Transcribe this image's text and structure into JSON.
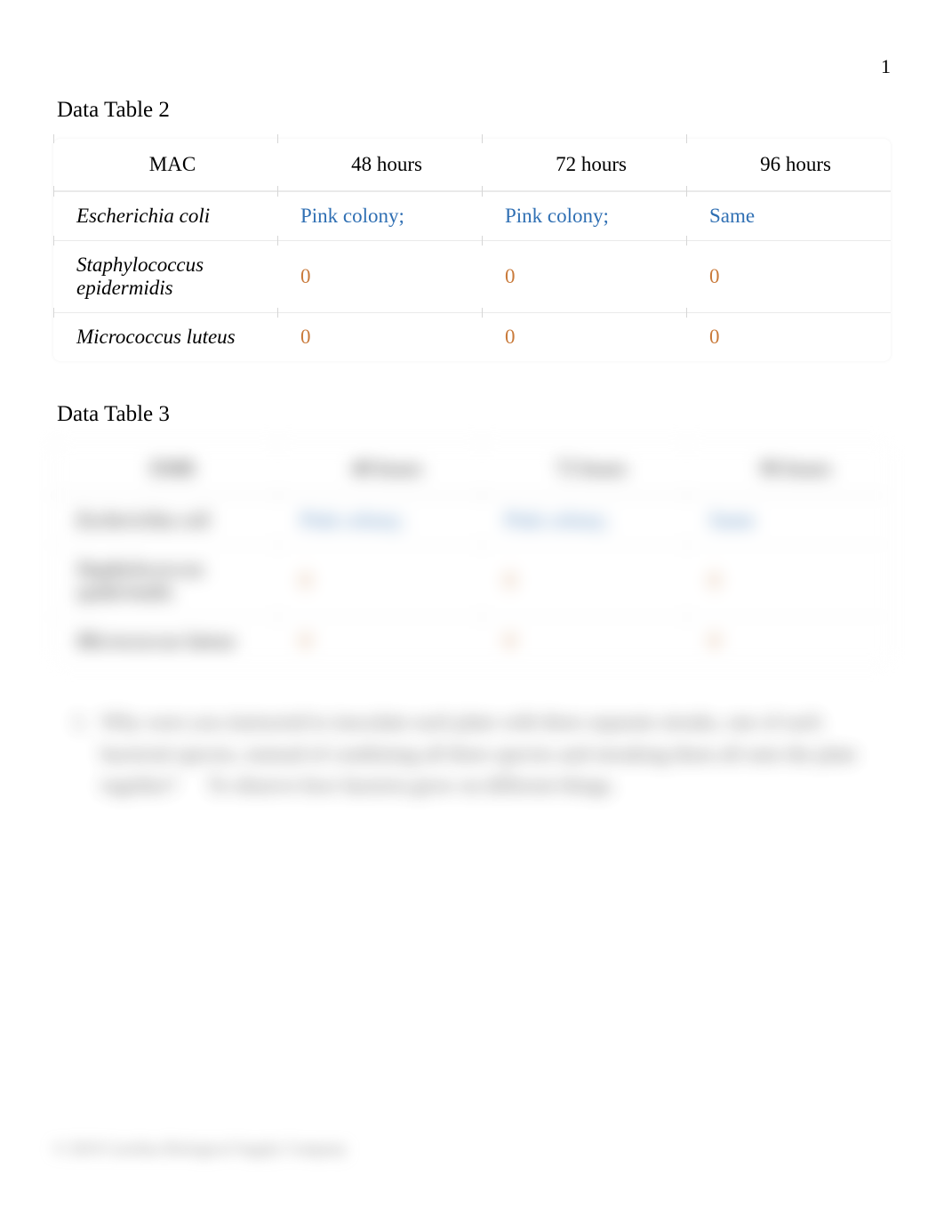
{
  "page_number": "1",
  "table2": {
    "title": "Data Table 2",
    "header": [
      "MAC",
      "48 hours",
      "72 hours",
      "96 hours"
    ],
    "rows": [
      {
        "name": "Escherichia coli",
        "italic": true,
        "values": [
          "Pink colony;",
          "Pink colony;",
          "Same"
        ],
        "color": "blue"
      },
      {
        "name": "Staphylococcus epidermidis",
        "italic": true,
        "values": [
          "0",
          "0",
          "0"
        ],
        "color": "orange"
      },
      {
        "name": "Micrococcus luteus",
        "italic": true,
        "values": [
          "0",
          "0",
          "0"
        ],
        "color": "orange"
      }
    ]
  },
  "table3": {
    "title": "Data Table 3",
    "header": [
      "EMB",
      "48 hours",
      "72 hours",
      "96 hours"
    ],
    "rows": [
      {
        "name": "Escherichia coli",
        "italic": true,
        "values": [
          "Pink colony;",
          "Pink colony;",
          "Same"
        ],
        "color": "blue"
      },
      {
        "name": "Staphylococcus epidermidis",
        "italic": true,
        "values": [
          "0",
          "0",
          "0"
        ],
        "color": "orange"
      },
      {
        "name": "Micrococcus luteus",
        "italic": true,
        "values": [
          "0",
          "0",
          "0"
        ],
        "color": "orange"
      }
    ]
  },
  "question": {
    "number": "1.",
    "text": "Why were you instructed to inoculate each plate with three separate streaks, one of each bacterial species, instead of combining all three species and streaking them all onto the plate together?",
    "answer": "To observe how bacteria grow on different things."
  },
  "footer": "© 2019 Carolina Biological Supply Company"
}
